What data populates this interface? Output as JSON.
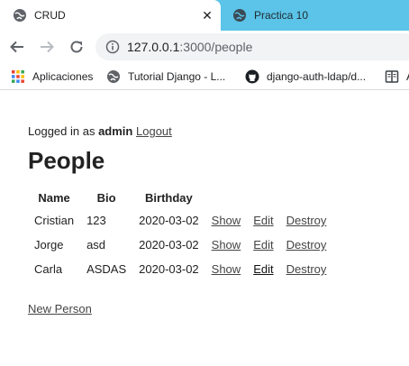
{
  "tabs": [
    {
      "title": "CRUD",
      "active": true,
      "close_glyph": "✕"
    },
    {
      "title": "Practica 10",
      "active": false
    }
  ],
  "address_bar": {
    "host": "127.0.0.1",
    "path": ":3000/people"
  },
  "bookmarks": [
    {
      "label": "Aplicaciones",
      "icon": "apps-grid-icon"
    },
    {
      "label": "Tutorial Django - L...",
      "icon": "globe-icon"
    },
    {
      "label": "django-auth-ldap/d...",
      "icon": "github-icon"
    },
    {
      "label": "A",
      "icon": "book-icon"
    }
  ],
  "page": {
    "logged_in_prefix": "Logged in as",
    "username": "admin",
    "logout_label": "Logout",
    "title": "People",
    "table": {
      "headers": [
        "Name",
        "Bio",
        "Birthday"
      ],
      "rows": [
        {
          "name": "Cristian",
          "bio": "123",
          "birthday": "2020-03-02"
        },
        {
          "name": "Jorge",
          "bio": "asd",
          "birthday": "2020-03-02"
        },
        {
          "name": "Carla",
          "bio": "ASDAS",
          "birthday": "2020-03-02"
        }
      ],
      "actions": {
        "show": "Show",
        "edit": "Edit",
        "destroy": "Destroy"
      }
    },
    "new_person_label": "New Person"
  },
  "colors": {
    "tabstrip": "#5bc4e8",
    "link": "#444444"
  }
}
